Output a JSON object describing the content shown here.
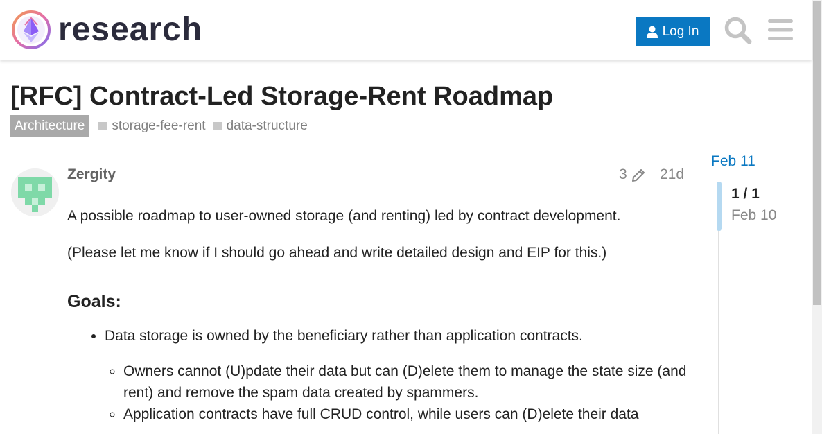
{
  "header": {
    "brand": "research",
    "login_label": "Log In",
    "icons": [
      "search-icon",
      "hamburger-menu-icon",
      "user-icon"
    ],
    "accent_color": "#0a78c2"
  },
  "topic": {
    "title": "[RFC] Contract-Led Storage-Rent Roadmap",
    "category": "Architecture",
    "tags": [
      "storage-fee-rent",
      "data-structure"
    ]
  },
  "post": {
    "author": "Zergity",
    "edit_count": "3",
    "age": "21d",
    "paragraph_1": "A possible roadmap to user-owned storage (and renting) led by contract development.",
    "paragraph_2": "(Please let me know if I should go ahead and write detailed design and EIP for this.)",
    "heading": "Goals:",
    "bullet_1": "Data storage is owned by the beneficiary rather than application contracts.",
    "sub_bullets": [
      "Owners cannot (U)pdate their data but can (D)elete them to manage the state size (and rent) and remove the spam data created by spammers.",
      "Application contracts have full CRUD control, while users can (D)elete their data"
    ]
  },
  "timeline": {
    "start_date": "Feb 11",
    "position": "1 / 1",
    "current_date": "Feb 10"
  }
}
